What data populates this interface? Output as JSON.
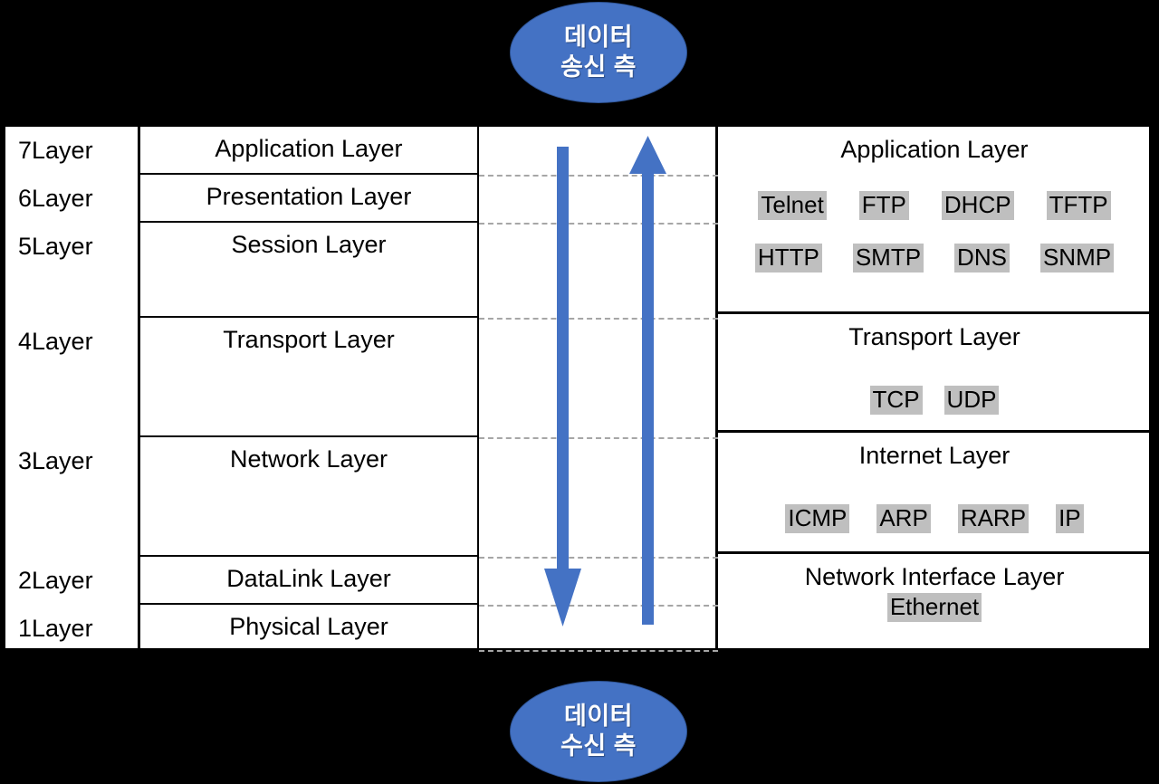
{
  "endpoints": {
    "top": {
      "line1": "데이터",
      "line2": "송신 측"
    },
    "bottom": {
      "line1": "데이터",
      "line2": "수신 측"
    }
  },
  "colors": {
    "accent_blue": "#4472C4",
    "arrow_blue": "#4472C4",
    "protocol_highlight_gray": "#BFBFBF",
    "dashed_line_gray": "#A6A6A6",
    "border_black": "#000000",
    "background_black": "#000000",
    "table_white": "#FFFFFF"
  },
  "osi_model": {
    "layers": [
      {
        "number": "7Layer",
        "name": "Application Layer"
      },
      {
        "number": "6Layer",
        "name": "Presentation Layer"
      },
      {
        "number": "5Layer",
        "name": "Session Layer"
      },
      {
        "number": "4Layer",
        "name": "Transport Layer"
      },
      {
        "number": "3Layer",
        "name": "Network Layer"
      },
      {
        "number": "2Layer",
        "name": "DataLink Layer"
      },
      {
        "number": "1Layer",
        "name": "Physical Layer"
      }
    ]
  },
  "tcpip_model": {
    "layers": [
      {
        "name": "Application Layer",
        "protocol_rows": [
          [
            "Telnet",
            "FTP",
            "DHCP",
            "TFTP"
          ],
          [
            "HTTP",
            "SMTP",
            "DNS",
            "SNMP"
          ]
        ]
      },
      {
        "name": "Transport Layer",
        "protocol_rows": [
          [
            "TCP",
            "UDP"
          ]
        ]
      },
      {
        "name": "Internet Layer",
        "protocol_rows": [
          [
            "ICMP",
            "ARP",
            "RARP",
            "IP"
          ]
        ]
      },
      {
        "name": "Network Interface Layer",
        "protocol_rows": [
          [
            "Ethernet"
          ]
        ]
      }
    ]
  },
  "transit": {
    "down_arrow_label": "data-encapsulation-downward",
    "up_arrow_label": "data-decapsulation-upward"
  }
}
